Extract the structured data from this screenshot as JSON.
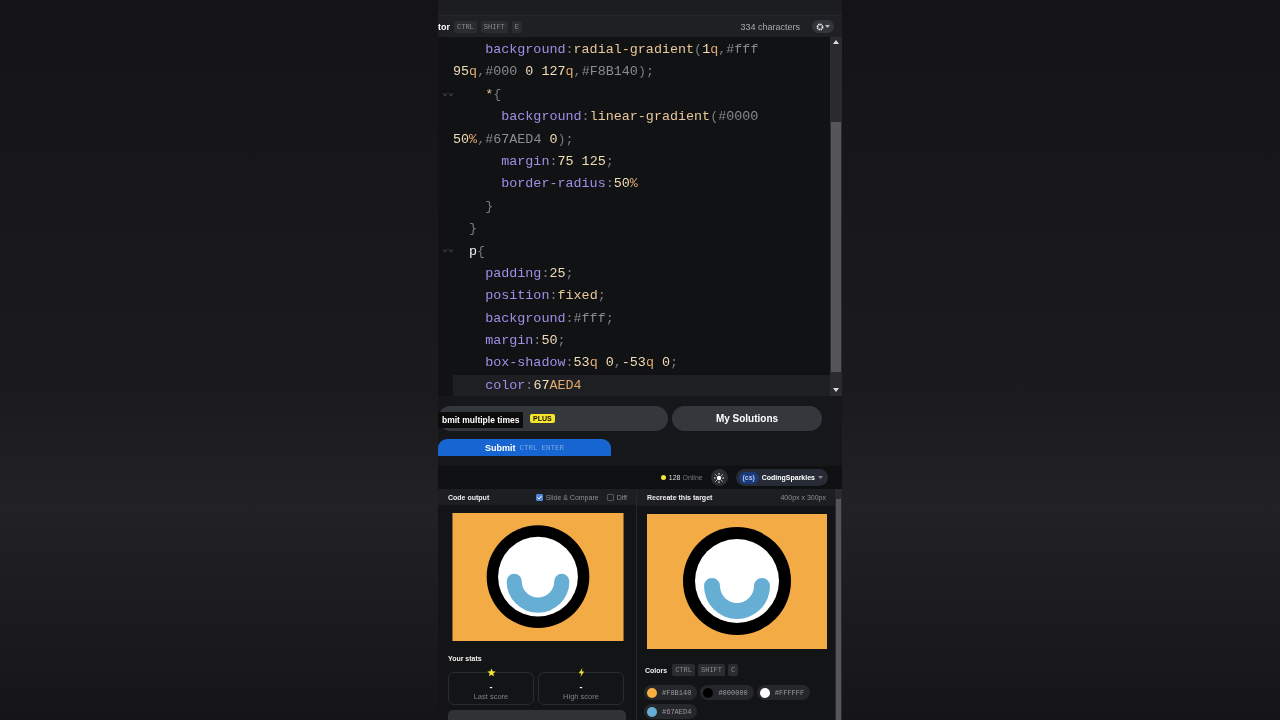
{
  "editor": {
    "title": "tor",
    "shortcut": [
      "CTRL",
      "SHIFT",
      "E"
    ],
    "char_count": "334 characters",
    "lines": [
      {
        "fold": false,
        "current": false,
        "tokens": [
          {
            "kind": "prop",
            "text": "    background"
          },
          {
            "kind": "punct",
            "text": ":"
          },
          {
            "kind": "fn",
            "text": "radial-gradient"
          },
          {
            "kind": "punct",
            "text": "("
          },
          {
            "kind": "num",
            "text": "1"
          },
          {
            "kind": "unit",
            "text": "q"
          },
          {
            "kind": "punct",
            "text": ","
          },
          {
            "kind": "hex",
            "text": "#fff"
          }
        ]
      },
      {
        "fold": false,
        "current": false,
        "tokens": [
          {
            "kind": "num",
            "text": "95"
          },
          {
            "kind": "unit",
            "text": "q"
          },
          {
            "kind": "punct",
            "text": ","
          },
          {
            "kind": "hex",
            "text": "#000"
          },
          {
            "kind": "num",
            "text": " 0 127"
          },
          {
            "kind": "unit",
            "text": "q"
          },
          {
            "kind": "punct",
            "text": ","
          },
          {
            "kind": "hex",
            "text": "#F8B140"
          },
          {
            "kind": "punct",
            "text": ");"
          }
        ]
      },
      {
        "fold": true,
        "current": false,
        "tokens": [
          {
            "kind": "fn",
            "text": "    *"
          },
          {
            "kind": "punct",
            "text": "{"
          }
        ]
      },
      {
        "fold": false,
        "current": false,
        "tokens": [
          {
            "kind": "prop",
            "text": "      background"
          },
          {
            "kind": "punct",
            "text": ":"
          },
          {
            "kind": "fn",
            "text": "linear-gradient"
          },
          {
            "kind": "punct",
            "text": "("
          },
          {
            "kind": "hex",
            "text": "#0000"
          }
        ]
      },
      {
        "fold": false,
        "current": false,
        "tokens": [
          {
            "kind": "num",
            "text": "50"
          },
          {
            "kind": "unit",
            "text": "%"
          },
          {
            "kind": "punct",
            "text": ","
          },
          {
            "kind": "hex",
            "text": "#67AED4"
          },
          {
            "kind": "num",
            "text": " 0"
          },
          {
            "kind": "punct",
            "text": ");"
          }
        ]
      },
      {
        "fold": false,
        "current": false,
        "tokens": [
          {
            "kind": "prop",
            "text": "      margin"
          },
          {
            "kind": "punct",
            "text": ":"
          },
          {
            "kind": "num",
            "text": "75 125"
          },
          {
            "kind": "punct",
            "text": ";"
          }
        ]
      },
      {
        "fold": false,
        "current": false,
        "tokens": [
          {
            "kind": "prop",
            "text": "      border-radius"
          },
          {
            "kind": "punct",
            "text": ":"
          },
          {
            "kind": "num",
            "text": "50"
          },
          {
            "kind": "unit",
            "text": "%"
          }
        ]
      },
      {
        "fold": false,
        "current": false,
        "tokens": [
          {
            "kind": "punct",
            "text": "    }"
          }
        ]
      },
      {
        "fold": false,
        "current": false,
        "tokens": [
          {
            "kind": "punct",
            "text": "  }"
          }
        ]
      },
      {
        "fold": true,
        "current": false,
        "tokens": [
          {
            "kind": "sel",
            "text": "  p"
          },
          {
            "kind": "punct",
            "text": "{"
          }
        ]
      },
      {
        "fold": false,
        "current": false,
        "tokens": [
          {
            "kind": "prop",
            "text": "    padding"
          },
          {
            "kind": "punct",
            "text": ":"
          },
          {
            "kind": "num",
            "text": "25"
          },
          {
            "kind": "punct",
            "text": ";"
          }
        ]
      },
      {
        "fold": false,
        "current": false,
        "tokens": [
          {
            "kind": "prop",
            "text": "    position"
          },
          {
            "kind": "punct",
            "text": ":"
          },
          {
            "kind": "fn",
            "text": "fixed"
          },
          {
            "kind": "punct",
            "text": ";"
          }
        ]
      },
      {
        "fold": false,
        "current": false,
        "tokens": [
          {
            "kind": "prop",
            "text": "    background"
          },
          {
            "kind": "punct",
            "text": ":"
          },
          {
            "kind": "hex",
            "text": "#fff"
          },
          {
            "kind": "punct",
            "text": ";"
          }
        ]
      },
      {
        "fold": false,
        "current": false,
        "tokens": [
          {
            "kind": "prop",
            "text": "    margin"
          },
          {
            "kind": "punct",
            "text": ":"
          },
          {
            "kind": "num",
            "text": "50"
          },
          {
            "kind": "punct",
            "text": ";"
          }
        ]
      },
      {
        "fold": false,
        "current": false,
        "tokens": [
          {
            "kind": "prop",
            "text": "    box-shadow"
          },
          {
            "kind": "punct",
            "text": ":"
          },
          {
            "kind": "num",
            "text": "53"
          },
          {
            "kind": "unit",
            "text": "q"
          },
          {
            "kind": "num",
            "text": " 0"
          },
          {
            "kind": "punct",
            "text": ","
          },
          {
            "kind": "num",
            "text": "-53"
          },
          {
            "kind": "unit",
            "text": "q"
          },
          {
            "kind": "num",
            "text": " 0"
          },
          {
            "kind": "punct",
            "text": ";"
          }
        ]
      },
      {
        "fold": false,
        "current": true,
        "tokens": [
          {
            "kind": "prop",
            "text": "    color"
          },
          {
            "kind": "punct",
            "text": ":"
          },
          {
            "kind": "num",
            "text": "67"
          },
          {
            "kind": "unit",
            "text": "AED4"
          }
        ]
      }
    ]
  },
  "actions": {
    "plus_badge": "PLUS",
    "tooltip": "bmit multiple times",
    "solutions_button": "My Solutions",
    "submit": {
      "label": "Submit",
      "shortcut": [
        "CTRL",
        "ENTER"
      ]
    }
  },
  "topbar": {
    "online_count": "128",
    "online_label": "Online",
    "user": {
      "initials": "(cs)",
      "name": "CodingSparkles"
    }
  },
  "output_panel": {
    "title": "Code output",
    "options": [
      {
        "label": "Slide & Compare",
        "checked": true
      },
      {
        "label": "Diff",
        "checked": false
      }
    ],
    "stats_title": "Your stats",
    "stats": [
      {
        "kind": "star",
        "value": "-",
        "label": "Last score"
      },
      {
        "kind": "bolt",
        "value": "-",
        "label": "High score"
      }
    ]
  },
  "target_panel": {
    "title": "Recreate this target",
    "size": "400px x 300px",
    "colors_title": "Colors",
    "shortcut": [
      "CTRL",
      "SHIFT",
      "C"
    ],
    "colors": [
      {
        "label": "#F8B140",
        "color": "#f8b140"
      },
      {
        "label": "#000000",
        "color": "#000000"
      },
      {
        "label": "#FFFFFF",
        "color": "#ffffff"
      },
      {
        "label": "#67AED4",
        "color": "#67aed4"
      }
    ]
  }
}
